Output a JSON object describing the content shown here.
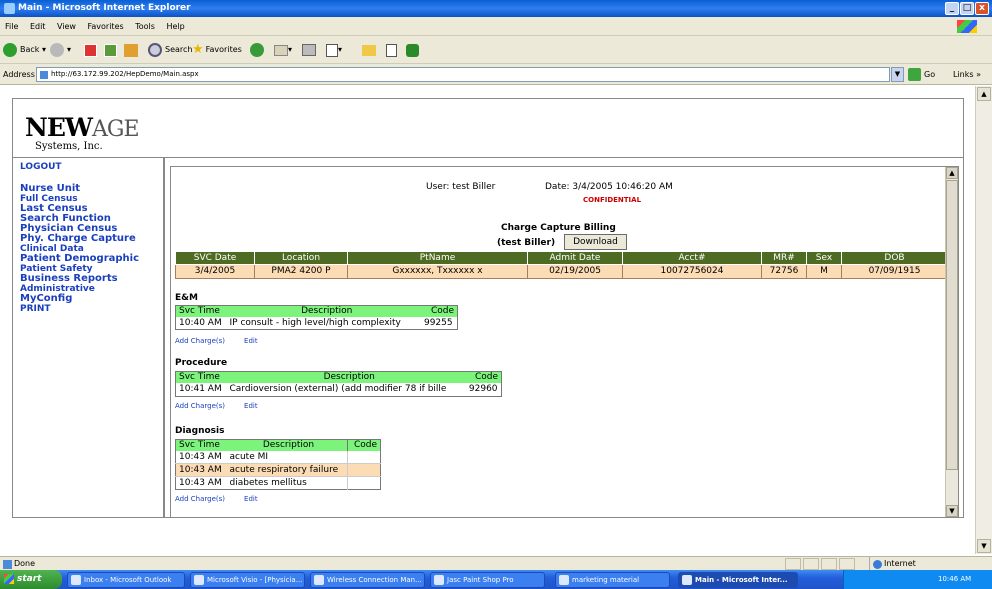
{
  "window": {
    "title": "Main - Microsoft Internet Explorer",
    "buttons": [
      "_",
      "□",
      "x"
    ]
  },
  "menu": [
    "File",
    "Edit",
    "View",
    "Favorites",
    "Tools",
    "Help"
  ],
  "toolbar": {
    "back": "Back",
    "search": "Search",
    "favorites": "Favorites"
  },
  "address": {
    "label": "Address",
    "url": "http://63.172.99.202/HepDemo/Main.aspx",
    "go": "Go",
    "links": "Links"
  },
  "logo": {
    "brand_new": "NEW",
    "brand_age": "AGE",
    "sub": "Systems, Inc."
  },
  "nav": {
    "logout": "LOGOUT",
    "items": [
      "Nurse Unit",
      "Full Census",
      "Last Census",
      "Search Function",
      "Physician Census",
      "Phy. Charge Capture",
      "Clinical Data",
      "Patient Demographic",
      "Patient Safety",
      "Business Reports",
      "Administrative",
      "MyConfig",
      "PRINT"
    ]
  },
  "header": {
    "user_label": "User: test Biller",
    "date_label": "Date: 3/4/2005 10:46:20 AM",
    "confidential": "CONFIDENTIAL",
    "title": "Charge Capture Billing",
    "subtitle": "(test Biller)",
    "download": "Download"
  },
  "patient_table": {
    "columns": [
      "SVC Date",
      "Location",
      "PtName",
      "Admit Date",
      "Acct#",
      "MR#",
      "Sex",
      "DOB"
    ],
    "row": [
      "3/4/2005",
      "PMA2 4200 P",
      "Gxxxxxx, Txxxxxx x",
      "02/19/2005",
      "10072756024",
      "72756",
      "M",
      "07/09/1915"
    ]
  },
  "sections": {
    "em": {
      "title": "E&M",
      "columns": [
        "Svc Time",
        "Description",
        "Code"
      ],
      "rows": [
        [
          "10:40 AM",
          "IP consult - high level/high complexity",
          "99255"
        ]
      ]
    },
    "procedure": {
      "title": "Procedure",
      "columns": [
        "Svc Time",
        "Description",
        "Code"
      ],
      "rows": [
        [
          "10:41 AM",
          "Cardioversion (external) (add modifier 78 if bille",
          "92960"
        ]
      ]
    },
    "diagnosis": {
      "title": "Diagnosis",
      "columns": [
        "Svc Time",
        "Description",
        "Code"
      ],
      "rows": [
        [
          "10:43 AM",
          "acute MI",
          ""
        ],
        [
          "10:43 AM",
          "acute respiratory failure",
          ""
        ],
        [
          "10:43 AM",
          "diabetes mellitus",
          ""
        ]
      ]
    },
    "add_label": "Add Charge(s)",
    "edit_label": "Edit"
  },
  "status": {
    "text": "Done",
    "zone": "Internet"
  },
  "taskbar": {
    "start": "start",
    "tasks": [
      "Inbox - Microsoft Outlook",
      "Microsoft Visio - [Physicia...",
      "Wireless Connection Man...",
      "Jasc Paint Shop Pro",
      "marketing material",
      "Main - Microsoft Inter..."
    ],
    "clock": "10:46 AM"
  }
}
